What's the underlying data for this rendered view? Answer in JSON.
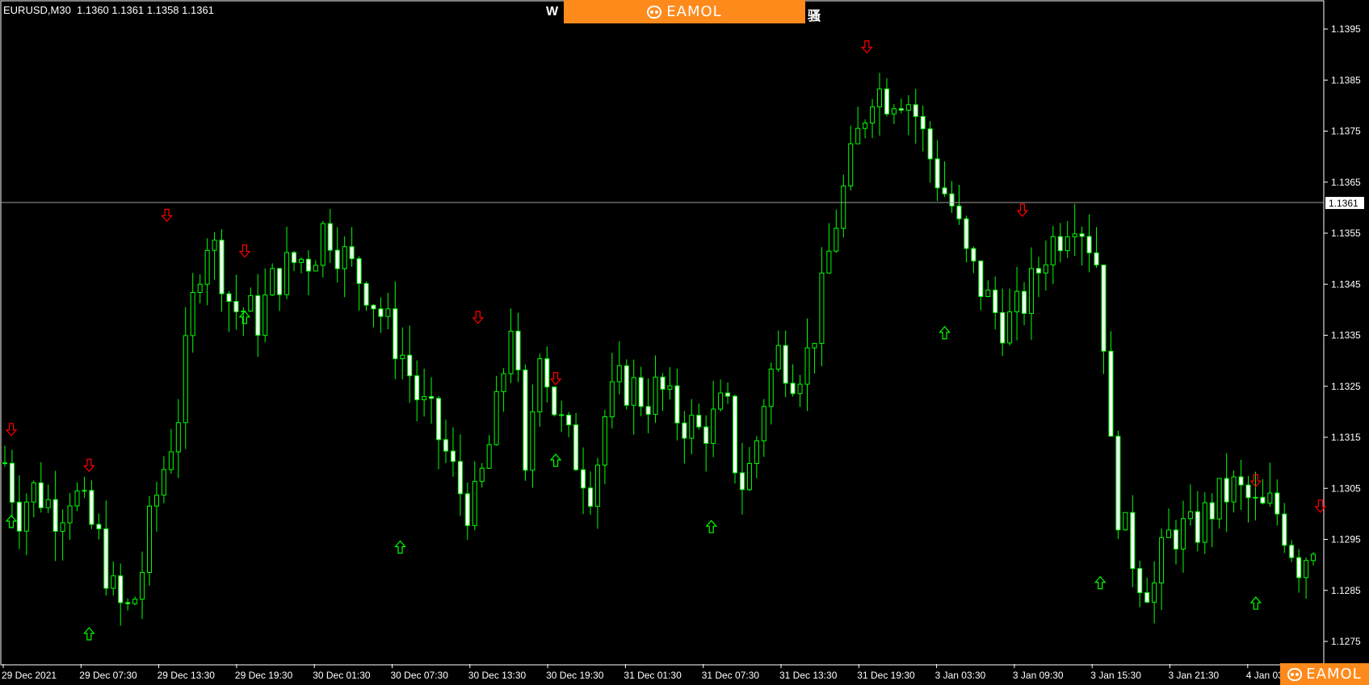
{
  "header": {
    "symbol_info": "EURUSD,M30  1.1360 1.1361 1.1358 1.1361",
    "title_left": "W",
    "title_right": "骚"
  },
  "branding": {
    "logo_text": "EAMOL"
  },
  "chart_data": {
    "type": "candlestick",
    "title": "",
    "symbol": "EURUSD",
    "timeframe": "M30",
    "ylim": [
      1.127,
      1.14
    ],
    "y_ticks": [
      "1.1395",
      "1.1385",
      "1.1375",
      "1.1365",
      "1.1355",
      "1.1345",
      "1.1335",
      "1.1325",
      "1.1315",
      "1.1305",
      "1.1295",
      "1.1285",
      "1.1275"
    ],
    "x_ticks": [
      "29 Dec 2021",
      "29 Dec 07:30",
      "29 Dec 13:30",
      "29 Dec 19:30",
      "30 Dec 01:30",
      "30 Dec 07:30",
      "30 Dec 13:30",
      "30 Dec 19:30",
      "31 Dec 01:30",
      "31 Dec 07:30",
      "31 Dec 13:30",
      "31 Dec 19:30",
      "3 Jan 03:30",
      "3 Jan 09:30",
      "3 Jan 15:30",
      "3 Jan 21:30",
      "4 Jan 03:30"
    ],
    "current_price": "1.1361",
    "colors": {
      "background": "#000000",
      "bull_body": "#000000",
      "bear_body": "#ffffff",
      "wick": "#00ff00",
      "buy_arrow": "#00ff00",
      "sell_arrow": "#ff0000",
      "price_line": "#a0a0a0"
    },
    "close_path": [
      1.131,
      1.13,
      1.1305,
      1.1303,
      1.13,
      1.1305,
      1.13,
      1.1295,
      1.1285,
      1.128,
      1.1285,
      1.13,
      1.131,
      1.132,
      1.134,
      1.1355,
      1.135,
      1.134,
      1.134,
      1.1338,
      1.1345,
      1.1348,
      1.135,
      1.135,
      1.1357,
      1.1352,
      1.1348,
      1.1345,
      1.134,
      1.1335,
      1.133,
      1.1322,
      1.1318,
      1.1312,
      1.1305,
      1.13,
      1.131,
      1.1322,
      1.134,
      1.1305,
      1.1335,
      1.1322,
      1.1315,
      1.131,
      1.1305,
      1.132,
      1.1325,
      1.1325,
      1.1322,
      1.1325,
      1.132,
      1.1318,
      1.1316,
      1.1318,
      1.1322,
      1.1305,
      1.131,
      1.1325,
      1.1332,
      1.1328,
      1.133,
      1.134,
      1.1355,
      1.1365,
      1.1375,
      1.1384,
      1.1382,
      1.1383,
      1.138,
      1.1372,
      1.1365,
      1.136,
      1.135,
      1.1345,
      1.134,
      1.1337,
      1.134,
      1.1345,
      1.1352,
      1.1355,
      1.136,
      1.1355,
      1.1348,
      1.1305,
      1.1295,
      1.1288,
      1.1285,
      1.1295,
      1.1297,
      1.1296,
      1.13,
      1.1303,
      1.1305,
      1.1303,
      1.13,
      1.1302,
      1.1296,
      1.129,
      1.1295
    ],
    "sell_signals": [
      {
        "time": "29 Dec 2021",
        "price": 1.1315
      },
      {
        "time": "29 Dec 07:30",
        "price": 1.1308
      },
      {
        "time": "29 Dec 13:30",
        "price": 1.1357
      },
      {
        "time": "29 Dec 19:30",
        "price": 1.135
      },
      {
        "time": "30 Dec 13:30",
        "price": 1.1337
      },
      {
        "time": "30 Dec 19:30",
        "price": 1.1325
      },
      {
        "time": "31 Dec 19:30",
        "price": 1.139
      },
      {
        "time": "3 Jan 09:30",
        "price": 1.1358
      },
      {
        "time": "4 Jan 03:30",
        "price": 1.1305
      },
      {
        "time": "4 Jan 03:30",
        "price": 1.13
      }
    ],
    "buy_signals": [
      {
        "time": "29 Dec 2021",
        "price": 1.13
      },
      {
        "time": "29 Dec 07:30",
        "price": 1.1278
      },
      {
        "time": "29 Dec 19:30",
        "price": 1.134
      },
      {
        "time": "30 Dec 07:30",
        "price": 1.1295
      },
      {
        "time": "30 Dec 19:30",
        "price": 1.1312
      },
      {
        "time": "31 Dec 07:30",
        "price": 1.1299
      },
      {
        "time": "3 Jan 03:30",
        "price": 1.1337
      },
      {
        "time": "3 Jan 15:30",
        "price": 1.1288
      },
      {
        "time": "4 Jan 03:30",
        "price": 1.1284
      }
    ]
  }
}
